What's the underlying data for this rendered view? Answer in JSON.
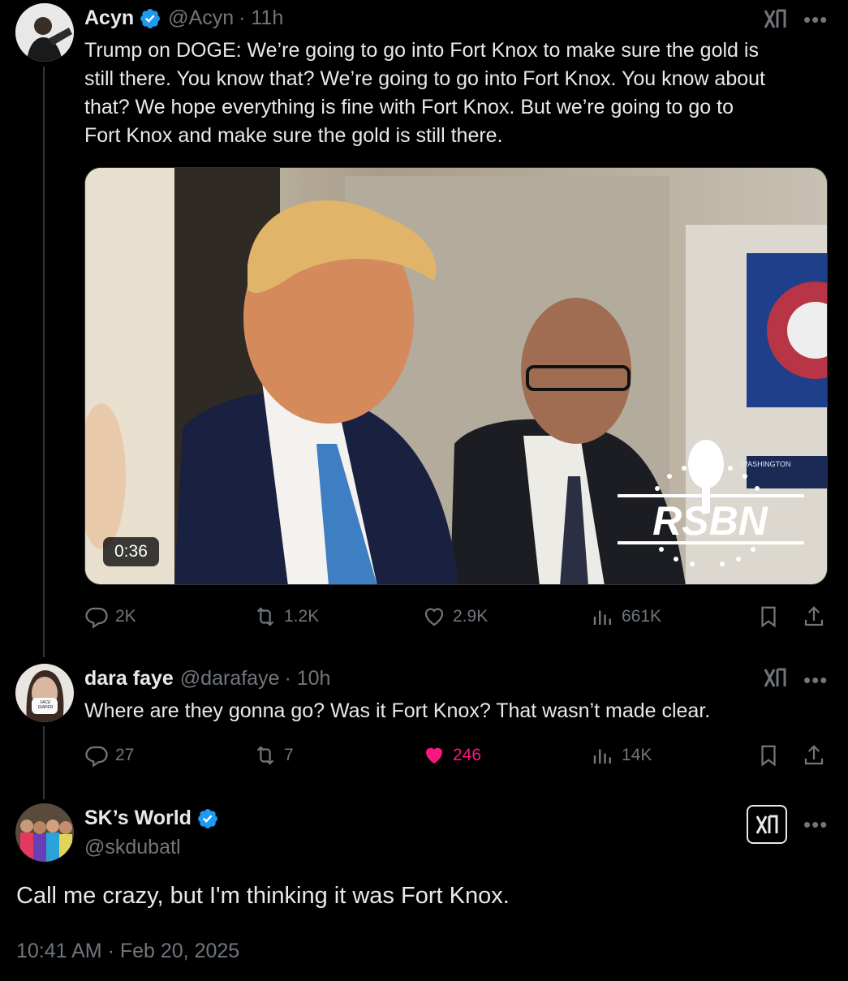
{
  "colors": {
    "background": "#000000",
    "text": "#e7e9ea",
    "muted": "#71767b",
    "verified": "#1d9bf0",
    "liked": "#f91880"
  },
  "tweets": [
    {
      "name": "Acyn",
      "handle": "@Acyn",
      "time": "· 11h",
      "verified": true,
      "text_lines": [
        "Trump on DOGE: We’re going to go into Fort Knox to make sure the gold is",
        "still there. You know that? We’re going to go into Fort Knox. You know about",
        "that? We hope everything is fine with Fort Knox. But we’re going to go to",
        "Fort Knox and make sure the gold is still there."
      ],
      "video": {
        "duration": "0:36",
        "watermark": "RSBN",
        "watermark_small": "WASHINGTON"
      },
      "stats": {
        "replies": "2K",
        "reposts": "1.2K",
        "likes": "2.9K",
        "views": "661K"
      }
    },
    {
      "name": "dara faye",
      "handle": "@darafaye",
      "time": "· 10h",
      "verified": false,
      "avatar_mask_text": "FACE DIAPER",
      "text": "Where are they gonna go? Was it Fort Knox? That wasn’t made clear.",
      "stats": {
        "replies": "27",
        "reposts": "7",
        "likes": "246",
        "views": "14K"
      },
      "liked": true
    },
    {
      "name": "SK’s World",
      "handle": "@skdubatl",
      "verified": true,
      "text": "Call me crazy, but I'm thinking it was Fort Knox.",
      "timestamp": "10:41 AM · Feb 20, 2025"
    }
  ],
  "icons": [
    "grok-icon",
    "more-icon",
    "reply-icon",
    "repost-icon",
    "like-icon",
    "views-icon",
    "bookmark-icon",
    "share-icon",
    "verified-icon"
  ]
}
